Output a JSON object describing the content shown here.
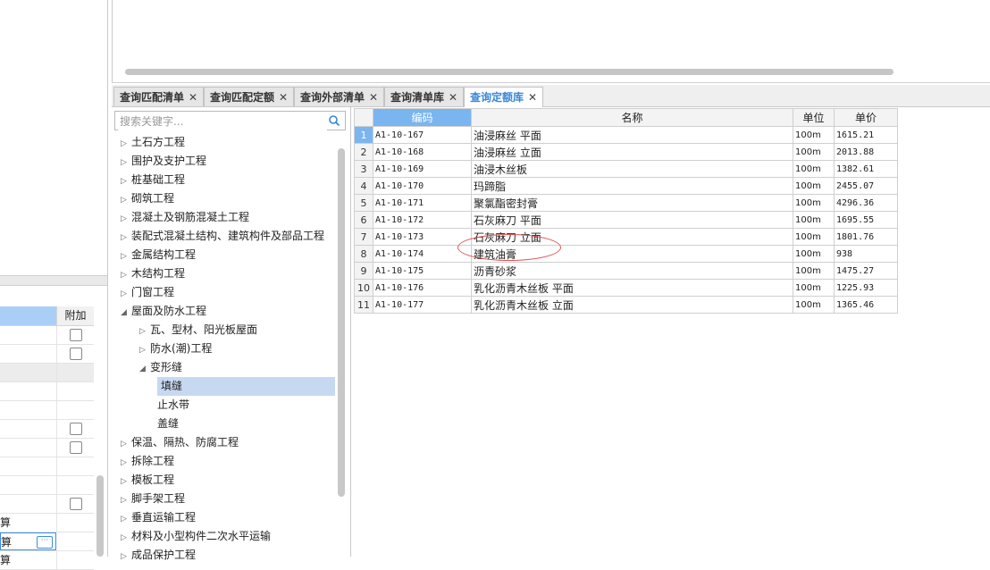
{
  "left_panel": {
    "header_col2": "附加",
    "rows": [
      {
        "text": "",
        "checkbox": true,
        "gray": false
      },
      {
        "text": "",
        "checkbox": true,
        "gray": false
      },
      {
        "text": "",
        "checkbox": false,
        "gray": true
      },
      {
        "text": "",
        "checkbox": false,
        "gray": false
      },
      {
        "text": "",
        "checkbox": false,
        "gray": false
      },
      {
        "text": "",
        "checkbox": true,
        "gray": false
      },
      {
        "text": "",
        "checkbox": true,
        "gray": false
      },
      {
        "text": "",
        "checkbox": false,
        "gray": false
      },
      {
        "text": "",
        "checkbox": false,
        "gray": false
      },
      {
        "text": "",
        "checkbox": true,
        "gray": false
      },
      {
        "text": "算",
        "checkbox": false,
        "gray": false
      },
      {
        "text": "算",
        "checkbox": false,
        "gray": false,
        "selected": true
      },
      {
        "text": "算",
        "checkbox": false,
        "gray": false
      }
    ]
  },
  "tabs": [
    {
      "label": "查询匹配清单",
      "active": false
    },
    {
      "label": "查询匹配定额",
      "active": false
    },
    {
      "label": "查询外部清单",
      "active": false
    },
    {
      "label": "查询清单库",
      "active": false
    },
    {
      "label": "查询定额库",
      "active": true
    }
  ],
  "tab_close_glyph": "✕",
  "search": {
    "placeholder": "搜索关键字...",
    "value": ""
  },
  "tree": [
    {
      "label": "土石方工程",
      "level": 0,
      "expanded": false
    },
    {
      "label": "围护及支护工程",
      "level": 0,
      "expanded": false
    },
    {
      "label": "桩基础工程",
      "level": 0,
      "expanded": false
    },
    {
      "label": "砌筑工程",
      "level": 0,
      "expanded": false
    },
    {
      "label": "混凝土及钢筋混凝土工程",
      "level": 0,
      "expanded": false
    },
    {
      "label": "装配式混凝土结构、建筑构件及部品工程",
      "level": 0,
      "expanded": false
    },
    {
      "label": "金属结构工程",
      "level": 0,
      "expanded": false
    },
    {
      "label": "木结构工程",
      "level": 0,
      "expanded": false
    },
    {
      "label": "门窗工程",
      "level": 0,
      "expanded": false
    },
    {
      "label": "屋面及防水工程",
      "level": 0,
      "expanded": true
    },
    {
      "label": "瓦、型材、阳光板屋面",
      "level": 1,
      "expanded": false
    },
    {
      "label": "防水(潮)工程",
      "level": 1,
      "expanded": false
    },
    {
      "label": "变形缝",
      "level": 1,
      "expanded": true
    },
    {
      "label": "填缝",
      "level": 2,
      "leaf": true,
      "selected": true
    },
    {
      "label": "止水带",
      "level": 2,
      "leaf": true
    },
    {
      "label": "盖缝",
      "level": 2,
      "leaf": true
    },
    {
      "label": "保温、隔热、防腐工程",
      "level": 0,
      "expanded": false
    },
    {
      "label": "拆除工程",
      "level": 0,
      "expanded": false
    },
    {
      "label": "模板工程",
      "level": 0,
      "expanded": false
    },
    {
      "label": "脚手架工程",
      "level": 0,
      "expanded": false
    },
    {
      "label": "垂直运输工程",
      "level": 0,
      "expanded": false
    },
    {
      "label": "材料及小型构件二次水平运输",
      "level": 0,
      "expanded": false
    },
    {
      "label": "成品保护工程",
      "level": 0,
      "expanded": false
    }
  ],
  "table": {
    "headers": {
      "code": "编码",
      "name": "名称",
      "unit": "单位",
      "price": "单价"
    },
    "rows": [
      {
        "no": "1",
        "code": "A1-10-167",
        "name": "油浸麻丝 平面",
        "unit": "100m",
        "price": "1615.21"
      },
      {
        "no": "2",
        "code": "A1-10-168",
        "name": "油浸麻丝 立面",
        "unit": "100m",
        "price": "2013.88"
      },
      {
        "no": "3",
        "code": "A1-10-169",
        "name": "油浸木丝板",
        "unit": "100m",
        "price": "1382.61"
      },
      {
        "no": "4",
        "code": "A1-10-170",
        "name": "玛蹄脂",
        "unit": "100m",
        "price": "2455.07"
      },
      {
        "no": "5",
        "code": "A1-10-171",
        "name": "聚氯酯密封膏",
        "unit": "100m",
        "price": "4296.36"
      },
      {
        "no": "6",
        "code": "A1-10-172",
        "name": "石灰麻刀 平面",
        "unit": "100m",
        "price": "1695.55"
      },
      {
        "no": "7",
        "code": "A1-10-173",
        "name": "石灰麻刀 立面",
        "unit": "100m",
        "price": "1801.76"
      },
      {
        "no": "8",
        "code": "A1-10-174",
        "name": "建筑油膏",
        "unit": "100m",
        "price": "938"
      },
      {
        "no": "9",
        "code": "A1-10-175",
        "name": "沥青砂浆",
        "unit": "100m",
        "price": "1475.27"
      },
      {
        "no": "10",
        "code": "A1-10-176",
        "name": "乳化沥青木丝板 平面",
        "unit": "100m",
        "price": "1225.93"
      },
      {
        "no": "11",
        "code": "A1-10-177",
        "name": "乳化沥青木丝板 立面",
        "unit": "100m",
        "price": "1365.46"
      }
    ]
  },
  "colors": {
    "accent": "#3a86d8",
    "header_blue": "#7ab5f0",
    "selection": "#c7d9f1",
    "annotation": "#e05050"
  }
}
